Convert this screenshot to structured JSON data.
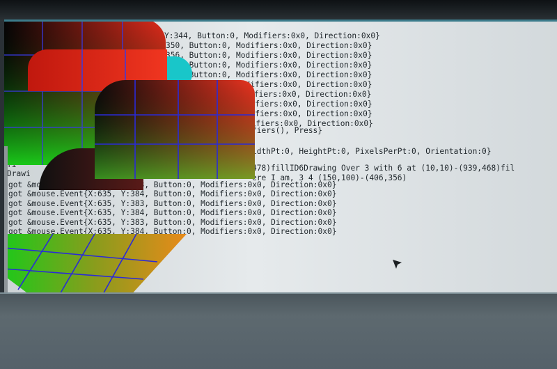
{
  "terminal": {
    "lines_top": [
      {
        "left": "g",
        "right": "Y:344, Button:0, Modifiers:0x0, Direction:0x0}"
      },
      {
        "left": "",
        "right": "350, Button:0, Modifiers:0x0, Direction:0x0}"
      },
      {
        "left": "",
        "right": "356, Button:0, Modifiers:0x0, Direction:0x0}"
      },
      {
        "left": "",
        "right": "362, Button:0, Modifiers:0x0, Direction:0x0}"
      },
      {
        "left": "",
        "right": "368, Button:0, Modifiers:0x0, Direction:0x0}"
      },
      {
        "left": "",
        "right": "373, Button:0, Modifiers:0x0, Direction:0x0}"
      },
      {
        "left": "",
        "right": "Modifiers:0x0, Direction:0x0}"
      },
      {
        "left": "",
        "right": "odifiers:0x0, Direction:0x0}"
      },
      {
        "left": "",
        "right": "odifiers:0x0, Direction:0x0}"
      },
      {
        "left": "",
        "right": "difiers:0x0, Direction:0x0}"
      },
      {
        "left": "",
        "right": "fiers(), Press}"
      },
      {
        "left": "",
        "right": ""
      },
      {
        "left": "",
        "right": "idthPt:0, HeightPt:0, PixelsPerPt:0, Orientation:0}"
      },
      {
        "left": "",
        "right": ""
      },
      {
        "left": "fi",
        "right": "478)fillID6Drawing Over 3 with 6 at (10,10)-(939,468)fil"
      },
      {
        "left": "Drawi",
        "right": "ere I am, 3 4 (150,100)-(406,356)"
      }
    ],
    "lines_full": [
      "got &mouse.Event{X:635, Y:383, Button:0, Modifiers:0x0, Direction:0x0}",
      "got &mouse.Event{X:635, Y:384, Button:0, Modifiers:0x0, Direction:0x0}",
      "got &mouse.Event{X:635, Y:383, Button:0, Modifiers:0x0, Direction:0x0}",
      "got &mouse.Event{X:635, Y:384, Button:0, Modifiers:0x0, Direction:0x0}",
      "got &mouse.Event{X:635, Y:383, Button:0, Modifiers:0x0, Direction:0x0}",
      "got &mouse.Event{X:635, Y:384, Button:0, Modifiers:0x0, Direction:0x0}"
    ]
  },
  "cursor": {
    "icon": "mouse-pointer-icon"
  },
  "colors": {
    "gradient_red": "#e8301c",
    "gradient_green": "#1fc81a",
    "gradient_orange": "#e8a018",
    "grid_line": "#2a2ad8",
    "cyan_shape": "#19c6c9",
    "text": "#1f262b"
  }
}
